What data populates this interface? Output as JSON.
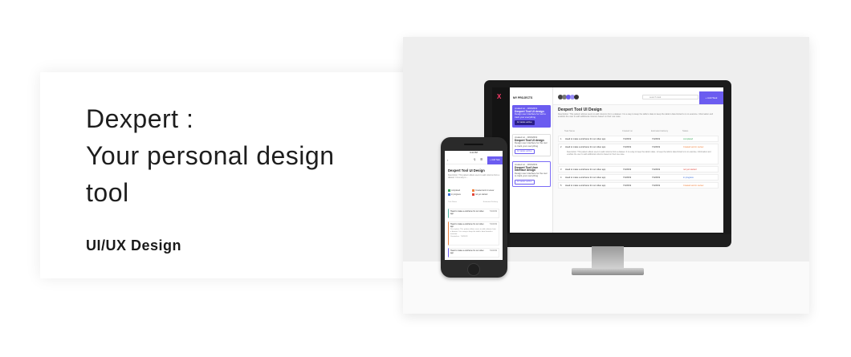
{
  "hero": {
    "title": "Dexpert :\nYour personal design\ntool",
    "subtitle": "UI/UX Design"
  },
  "desktop": {
    "logo": "X",
    "projects_heading": "MY PROJECTS",
    "project_cards": [
      {
        "meta": "created on - 18/4/2019",
        "title": "Dexpert Tool UI design",
        "desc": "Design user interface for tool to track your everything",
        "button": "12 tasks active"
      },
      {
        "meta": "created on - 18/4/2019",
        "title": "Dexpert Tool UI design",
        "desc": "Design user interface for the tool to track your everything",
        "button": "12 tasks active"
      },
      {
        "meta": "created on - 18/4/2019",
        "title": "Dexpert Tool User Interface design",
        "desc": "Design user interface for the tool to track your everything",
        "button": "12 tasks active"
      }
    ],
    "search_placeholder": "search task",
    "add_button": "+ Add Task",
    "heading": "Dexpert Tool UI Design",
    "description": "Description: This pattern allows users to add columns from a dataset. It is a way to keep the table's data to keep the table's data limited to is to examine. Information and enables the user to add additional columns based on their use case.",
    "table_headers": [
      "Task Name",
      "Created on",
      "Estimated delivery",
      "Status"
    ],
    "rows": [
      {
        "num": "1",
        "task": "Head to make a eireframe for our video app",
        "created": "7/4/2019",
        "delivery": "7/4/2019",
        "status": "completed",
        "status_color": "#3aa85a"
      },
      {
        "num": "2",
        "task": "Head to make a eireframe for our video app",
        "created": "7/4/2019",
        "delivery": "7/4/2019",
        "status": "Created and in review",
        "status_color": "#f0813c",
        "desc": "Description: This pattern allows users to add columns from a dataset. It is a way to keep the table's data - to keep the table's data limited to is to examine. Information and enables the user to add additional columns based on their use case."
      },
      {
        "num": "3",
        "task": "Head to make a eireframe for our video app",
        "created": "7/4/2019",
        "delivery": "7/4/2019",
        "status": "not yet started",
        "status_color": "#e0463c"
      },
      {
        "num": "4",
        "task": "Head to make a eireframe for our video app",
        "created": "7/4/2019",
        "delivery": "7/4/2019",
        "status": "in progress",
        "status_color": "#3b6fd8"
      },
      {
        "num": "5",
        "task": "Head to make a eireframe for our video app",
        "created": "7/4/2019",
        "delivery": "7/4/2019",
        "status": "Created and in review",
        "status_color": "#f0813c"
      }
    ]
  },
  "mobile": {
    "status_bar": "9:41 PM",
    "add_button": "+ Add Task",
    "heading": "Dexpert Tool UI Design",
    "description": "Description: This pattern allows users to add columns from a dataset. It is a way to ...",
    "legend": [
      {
        "label": "completed",
        "color": "#3aa85a"
      },
      {
        "label": "Created and in review",
        "color": "#f0813c"
      },
      {
        "label": "in progress",
        "color": "#3b6fd8"
      },
      {
        "label": "not yet started",
        "color": "#e0463c"
      }
    ],
    "table_headers": [
      "Task Name",
      "Estimated Delivery"
    ],
    "items": [
      {
        "num": "1",
        "task": "Head to make a eireframe for our video app",
        "date": "7/4/2019",
        "color": "#4fb3a4"
      },
      {
        "num": "2",
        "task": "Head to make a eireframe for our video app",
        "date": "7/4/2019",
        "color": "#f0813c",
        "desc": "Description: This pattern allows users to add columns from a dataset. It is a way to keep the table's data limited to examine.",
        "created": "Created on - 7/4/2019"
      },
      {
        "num": "3",
        "task": "Head to make a eireframe for our video app",
        "date": "7/4/2019",
        "color": "#6b5cf0"
      }
    ]
  }
}
